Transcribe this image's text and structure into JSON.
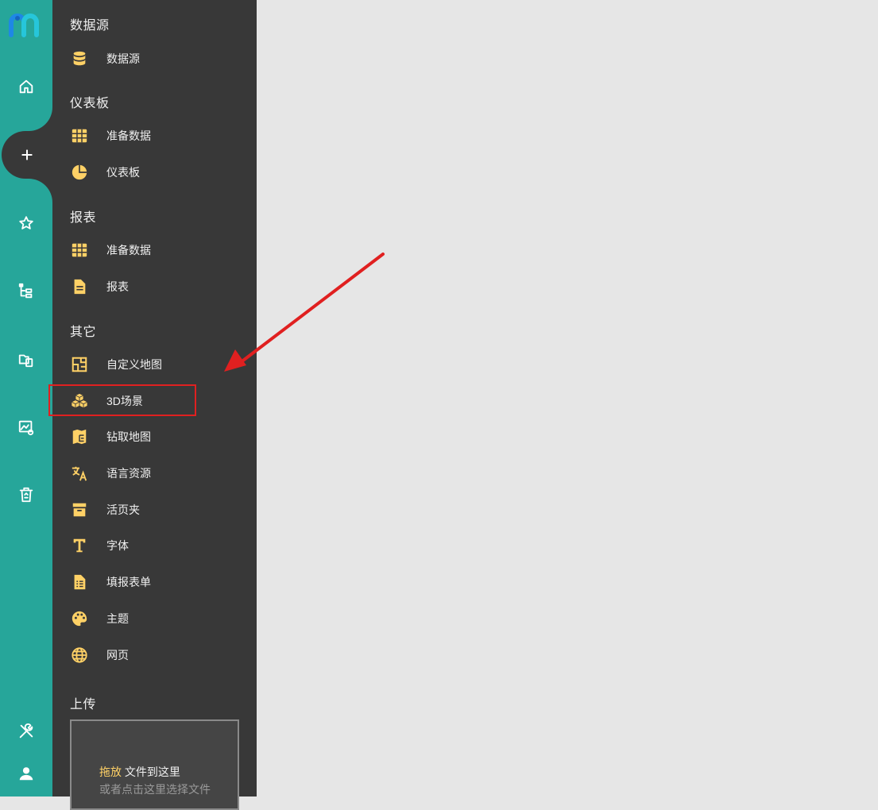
{
  "colors": {
    "rail": "#26a69a",
    "panel": "#383838",
    "canvas": "#e6e6e6",
    "icon_accent": "#ffd166",
    "highlight": "#e02020"
  },
  "rail": {
    "logo_icon": "m-logo-icon",
    "items": [
      {
        "icon": "home-icon"
      },
      {
        "icon": "plus-icon",
        "active": true
      },
      {
        "icon": "star-icon"
      },
      {
        "icon": "tree-icon"
      },
      {
        "icon": "folder-copy-icon"
      },
      {
        "icon": "image-monitor-icon"
      },
      {
        "icon": "trash-icon"
      },
      {
        "icon": "tools-icon"
      },
      {
        "icon": "user-icon"
      }
    ]
  },
  "sections": {
    "datasource": {
      "title": "数据源",
      "items": [
        {
          "label": "数据源",
          "icon": "database-icon"
        }
      ]
    },
    "dashboard": {
      "title": "仪表板",
      "items": [
        {
          "label": "准备数据",
          "icon": "grid-icon"
        },
        {
          "label": "仪表板",
          "icon": "pie-icon"
        }
      ]
    },
    "report": {
      "title": "报表",
      "items": [
        {
          "label": "准备数据",
          "icon": "grid-icon"
        },
        {
          "label": "报表",
          "icon": "document-icon"
        }
      ]
    },
    "other": {
      "title": "其它",
      "items": [
        {
          "label": "自定义地图",
          "icon": "floorplan-icon"
        },
        {
          "label": "3D场景",
          "icon": "cubes-icon",
          "highlighted": true
        },
        {
          "label": "钻取地图",
          "icon": "map-drill-icon"
        },
        {
          "label": "语言资源",
          "icon": "translate-icon"
        },
        {
          "label": "活页夹",
          "icon": "archive-icon"
        },
        {
          "label": "字体",
          "icon": "font-icon"
        },
        {
          "label": "填报表单",
          "icon": "form-icon"
        },
        {
          "label": "主题",
          "icon": "palette-icon"
        },
        {
          "label": "网页",
          "icon": "globe-icon"
        }
      ]
    },
    "upload": {
      "title": "上传",
      "drag_word": "拖放",
      "drag_rest": " 文件到这里",
      "choose": "或者点击这里选择文件"
    }
  }
}
